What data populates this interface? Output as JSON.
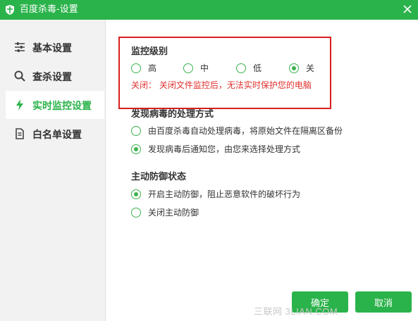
{
  "window": {
    "title": "百度杀毒-设置"
  },
  "sidebar": {
    "items": [
      {
        "label": "基本设置",
        "icon": "sliders-icon"
      },
      {
        "label": "查杀设置",
        "icon": "search-icon"
      },
      {
        "label": "实时监控设置",
        "icon": "lightning-icon",
        "active": true
      },
      {
        "label": "白名单设置",
        "icon": "document-icon"
      }
    ]
  },
  "monitor_level": {
    "title": "监控级别",
    "options": [
      "高",
      "中",
      "低",
      "关"
    ],
    "selected": "关",
    "warning": "关闭：  关闭文件监控后，无法实时保护您的电脑"
  },
  "virus_handling": {
    "title": "发现病毒的处理方式",
    "options": [
      "由百度杀毒自动处理病毒，将原始文件在隔离区备份",
      "发现病毒后通知您，由您来选择处理方式"
    ],
    "selected_index": 1
  },
  "active_defense": {
    "title": "主动防御状态",
    "options": [
      "开启主动防御，阻止恶意软件的破坏行为",
      "关闭主动防御"
    ],
    "selected_index": 0
  },
  "footer": {
    "ok_label": "确定",
    "cancel_label": "取消"
  },
  "watermark": "三联网 3LIAN.COM",
  "colors": {
    "accent": "#2bb34b",
    "warning": "#e0312f",
    "highlight_border": "#d81e1e"
  }
}
